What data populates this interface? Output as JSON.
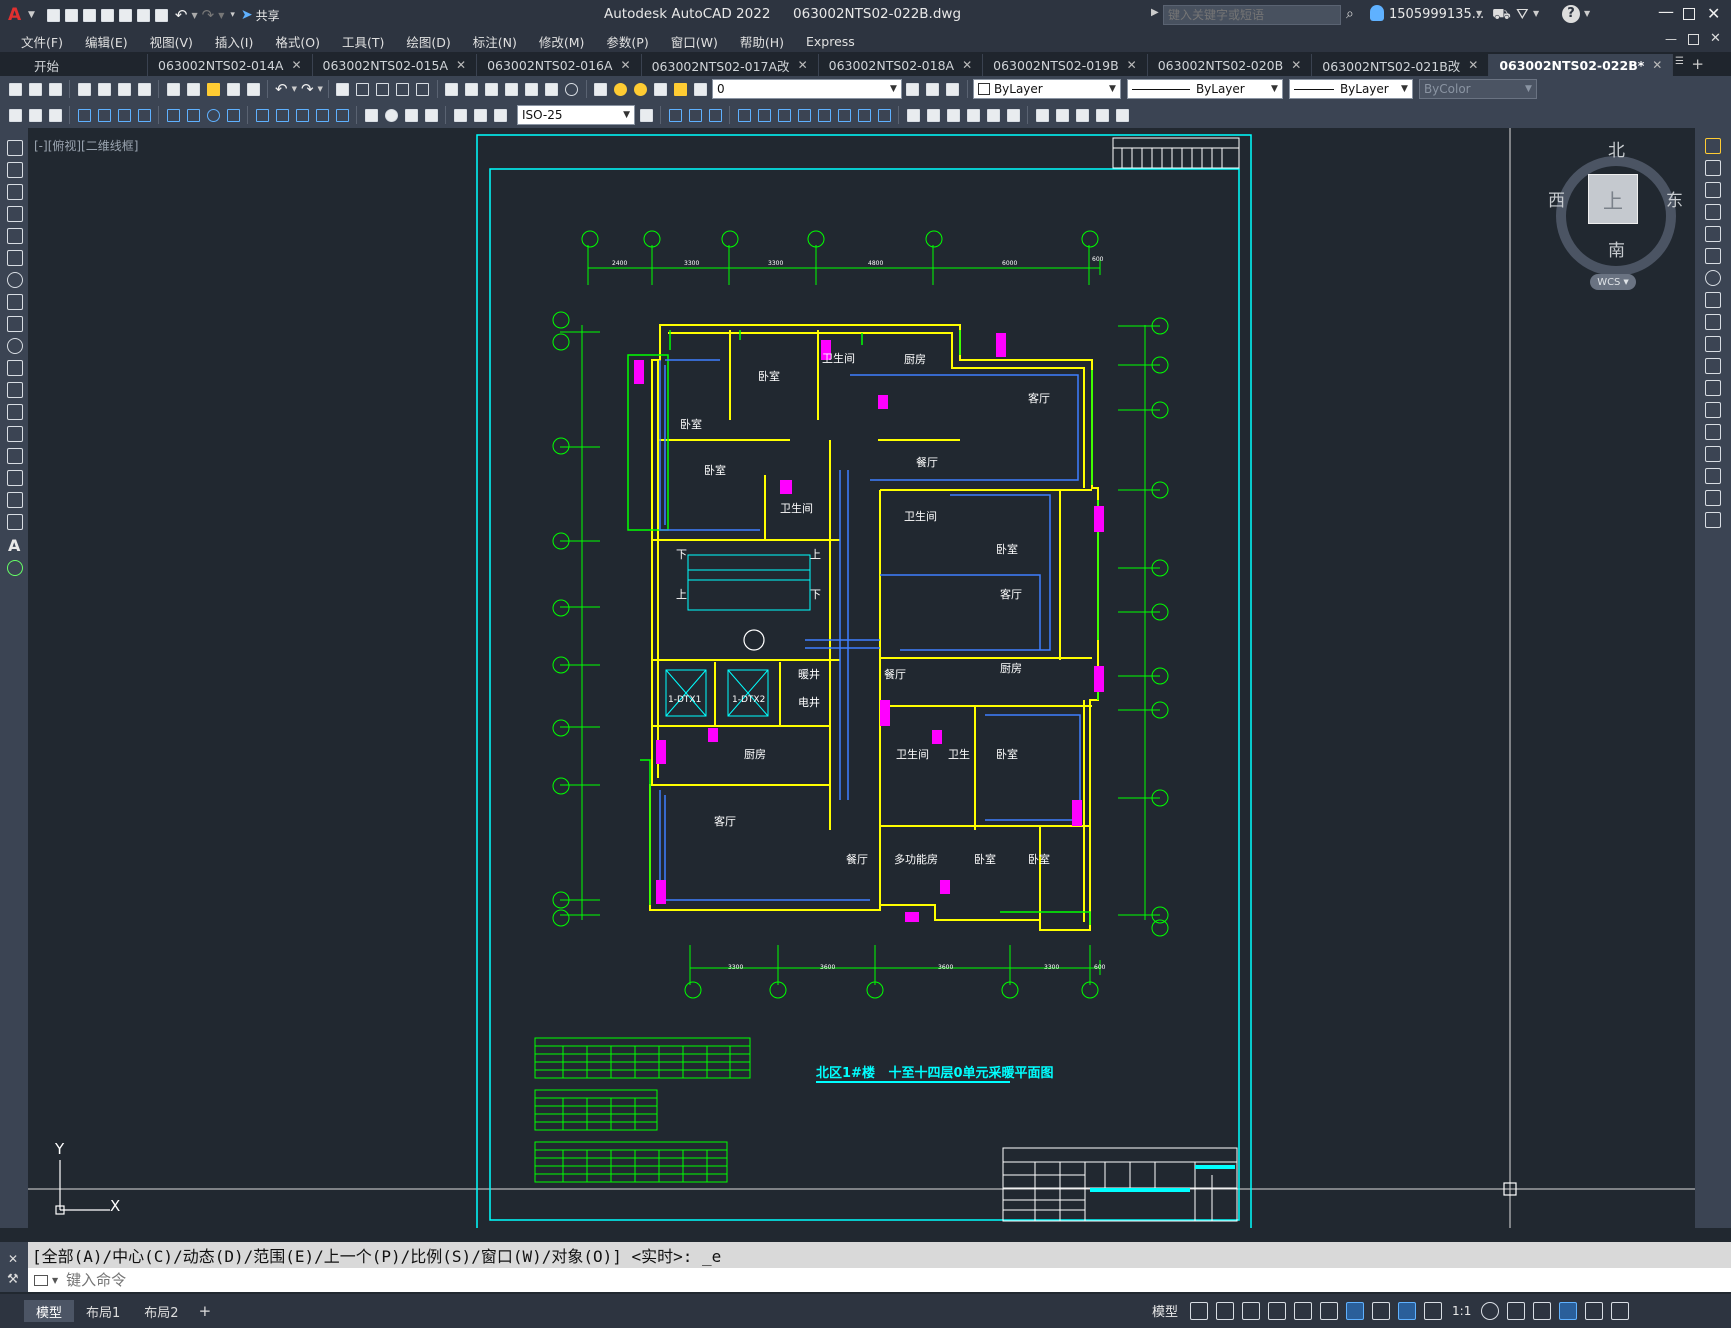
{
  "app": {
    "title": "Autodesk AutoCAD 2022",
    "filename": "063002NTS02-022B.dwg",
    "share_label": "共享",
    "search_placeholder": "键入关键字或短语",
    "user": "1505999135...",
    "express": "Express"
  },
  "menu": [
    "文件(F)",
    "编辑(E)",
    "视图(V)",
    "插入(I)",
    "格式(O)",
    "工具(T)",
    "绘图(D)",
    "标注(N)",
    "修改(M)",
    "参数(P)",
    "窗口(W)",
    "帮助(H)",
    "Express"
  ],
  "tabs": [
    {
      "label": "开始",
      "closable": false,
      "active": false
    },
    {
      "label": "063002NTS02-014A",
      "closable": true,
      "active": false
    },
    {
      "label": "063002NTS02-015A",
      "closable": true,
      "active": false
    },
    {
      "label": "063002NTS02-016A",
      "closable": true,
      "active": false
    },
    {
      "label": "063002NTS02-017A改",
      "closable": true,
      "active": false
    },
    {
      "label": "063002NTS02-018A",
      "closable": true,
      "active": false
    },
    {
      "label": "063002NTS02-019B",
      "closable": true,
      "active": false
    },
    {
      "label": "063002NTS02-020B",
      "closable": true,
      "active": false
    },
    {
      "label": "063002NTS02-021B改",
      "closable": true,
      "active": false
    },
    {
      "label": "063002NTS02-022B*",
      "closable": true,
      "active": true
    }
  ],
  "toolbar": {
    "layer_value": "0",
    "color_value": "ByLayer",
    "linetype_value": "ByLayer",
    "lineweight_value": "ByLayer",
    "plotstyle_value": "ByColor",
    "dimstyle_value": "ISO-25"
  },
  "viewport": {
    "label": "[-][俯视][二维线框]",
    "compass": {
      "north": "北",
      "south": "南",
      "east": "东",
      "west": "西",
      "top": "上"
    },
    "wcs": "WCS",
    "ucs_y": "Y",
    "ucs_x": "X"
  },
  "drawing": {
    "title": "北区1#楼   十至十四层0单元采暖平面图",
    "rooms": [
      {
        "name": "卧室"
      },
      {
        "name": "卧室"
      },
      {
        "name": "卫生间"
      },
      {
        "name": "厨房"
      },
      {
        "name": "客厅"
      },
      {
        "name": "卧室"
      },
      {
        "name": "餐厅"
      },
      {
        "name": "卫生间"
      },
      {
        "name": "卫生间"
      },
      {
        "name": "卧室"
      },
      {
        "name": "客厅"
      },
      {
        "name": "餐厅"
      },
      {
        "name": "厨房"
      },
      {
        "name": "暖井"
      },
      {
        "name": "电井"
      },
      {
        "name": "厨房"
      },
      {
        "name": "卫生间"
      },
      {
        "name": "卫生"
      },
      {
        "name": "卧室"
      },
      {
        "name": "客厅"
      },
      {
        "name": "餐厅"
      },
      {
        "name": "多功能房"
      },
      {
        "name": "卧室"
      },
      {
        "name": "卧室"
      }
    ],
    "stair_labels": [
      "下",
      "上",
      "上",
      "下"
    ],
    "elevators": [
      "1-DTX1",
      "1-DTX2"
    ],
    "top_dims": [
      "2400",
      "3300",
      "3300",
      "4800",
      "6000",
      "600"
    ],
    "bottom_dims": [
      "3300",
      "3600",
      "3600",
      "3300",
      "600"
    ]
  },
  "command": {
    "history": "[全部(A)/中心(C)/动态(D)/范围(E)/上一个(P)/比例(S)/窗口(W)/对象(O)] <实时>: _e",
    "placeholder": "键入命令"
  },
  "status": {
    "layouts": [
      "模型",
      "布局1",
      "布局2"
    ],
    "model_label": "模型",
    "scale": "1:1"
  },
  "colors": {
    "background": "#212830",
    "cyan": "#00ffff",
    "yellow": "#ffff00",
    "green": "#00ff00",
    "blue": "#3f7fff",
    "magenta": "#ff00ff"
  }
}
